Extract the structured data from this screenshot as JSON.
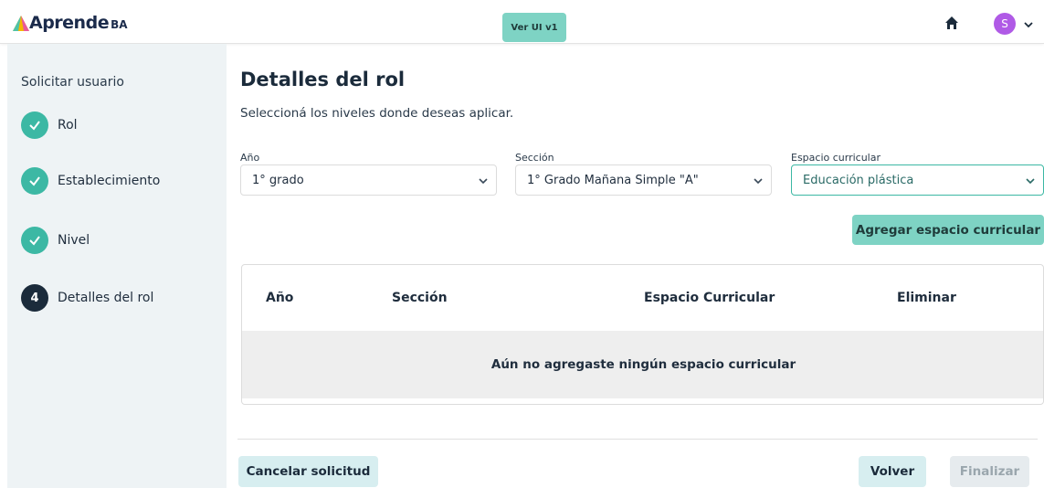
{
  "header": {
    "logo_text": "Aprende",
    "logo_suffix": "BA",
    "version_button": "Ver UI v1",
    "avatar_initial": "S"
  },
  "sidebar": {
    "title": "Solicitar usuario",
    "steps": [
      {
        "label": "Rol",
        "status": "done"
      },
      {
        "label": "Establecimiento",
        "status": "done"
      },
      {
        "label": "Nivel",
        "status": "done"
      },
      {
        "label": "Detalles del rol",
        "status": "current",
        "number": "4"
      }
    ]
  },
  "main": {
    "title": "Detalles del rol",
    "subtitle": "Seleccioná los niveles donde deseas aplicar.",
    "fields": {
      "anio": {
        "label": "Año",
        "value": "1° grado"
      },
      "seccion": {
        "label": "Sección",
        "value": "1° Grado Mañana Simple \"A\""
      },
      "espacio": {
        "label": "Espacio curricular",
        "value": "Educación plástica"
      }
    },
    "add_button": "Agregar espacio curricular",
    "table": {
      "columns": [
        "Año",
        "Sección",
        "Espacio Curricular",
        "Eliminar"
      ],
      "empty_message": "Aún no agregaste ningún espacio curricular"
    }
  },
  "footer": {
    "cancel": "Cancelar solicitud",
    "back": "Volver",
    "finish": "Finalizar"
  },
  "colors": {
    "accent": "#7ed3c4",
    "step_done": "#3cb8a4",
    "step_current": "#1b2b3b",
    "avatar": "#b05ae6"
  }
}
